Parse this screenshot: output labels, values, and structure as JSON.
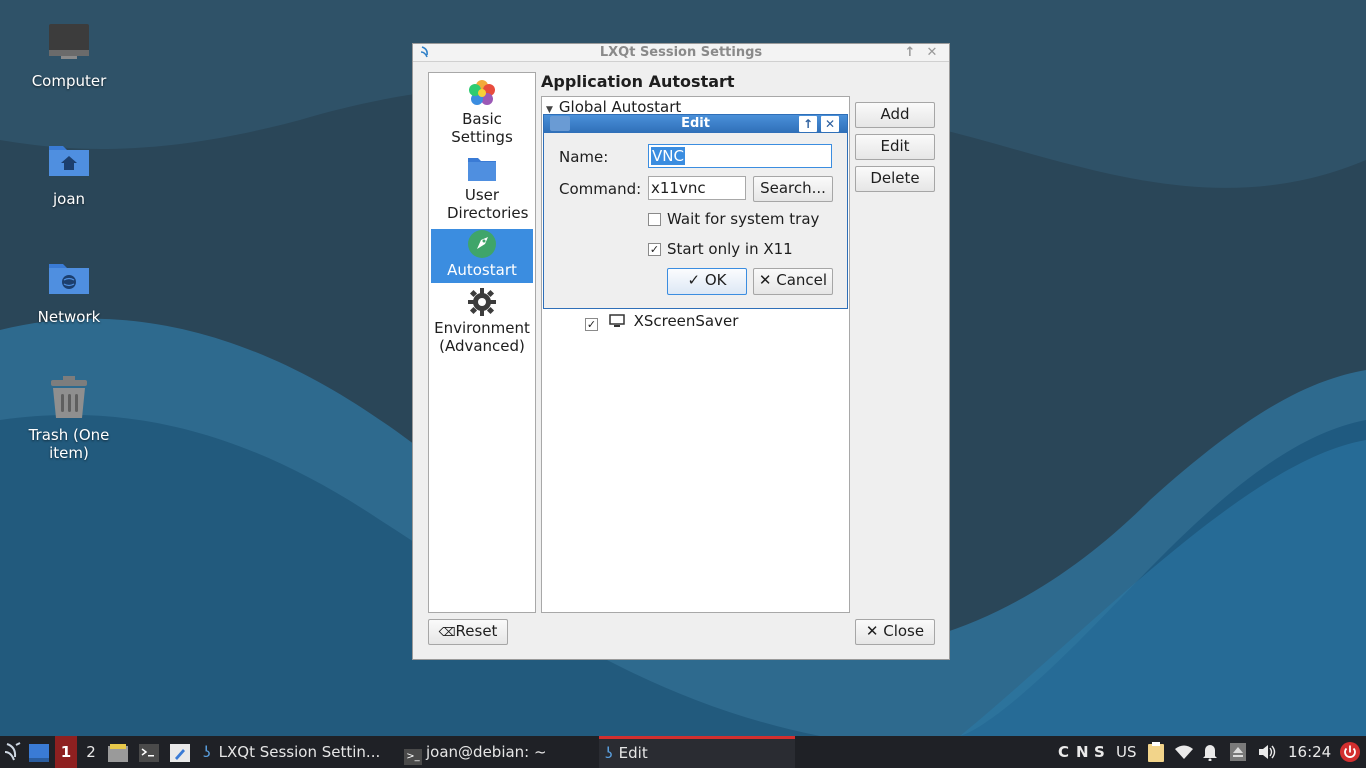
{
  "desktop": {
    "icons": [
      {
        "label": "Computer",
        "icon": "computer-icon"
      },
      {
        "label": "joan",
        "icon": "home-folder-icon"
      },
      {
        "label": "Network",
        "icon": "network-folder-icon"
      },
      {
        "label": "Trash (One item)",
        "icon": "trash-icon"
      }
    ]
  },
  "main_window": {
    "title": "LXQt Session Settings",
    "sidebar": [
      {
        "label": "Basic Settings",
        "icon": "colorful-flower-icon"
      },
      {
        "label": "User Directories",
        "icon": "folder-icon"
      },
      {
        "label": "Autostart",
        "icon": "rocket-icon",
        "selected": true
      },
      {
        "label": "Environment (Advanced)",
        "icon": "gear-icon"
      }
    ],
    "section_title": "Application Autostart",
    "tree": {
      "group": "Global Autostart",
      "items": [
        {
          "label": "XScreenSaver",
          "checked": true,
          "icon": "monitor-icon"
        }
      ]
    },
    "buttons": {
      "add": "Add",
      "edit": "Edit",
      "delete": "Delete",
      "reset": "Reset",
      "close": "Close"
    }
  },
  "edit_dialog": {
    "title": "Edit",
    "name_label": "Name:",
    "name_value": "VNC",
    "command_label": "Command:",
    "command_value": "x11vnc",
    "search_button": "Search...",
    "wait_tray_label": "Wait for system tray",
    "wait_tray_checked": false,
    "x11_label": "Start only in X11",
    "x11_checked": true,
    "ok": "OK",
    "cancel": "Cancel"
  },
  "taskbar": {
    "workspaces": [
      "1",
      "2"
    ],
    "tasks": [
      {
        "label": "LXQt Session Settin...",
        "icon": "lxqt-icon"
      },
      {
        "label": "joan@debian: ~",
        "icon": "terminal-icon"
      },
      {
        "label": "Edit",
        "icon": "lxqt-icon",
        "active": true
      }
    ],
    "indicators": [
      "C",
      "N",
      "S"
    ],
    "keyboard_layout": "US",
    "clock": "16:24"
  },
  "colors": {
    "selection": "#3b8de0",
    "taskbar": "#1f2126",
    "active_task_underline": "#d32f2f",
    "workspace_active": "#c0392b"
  }
}
